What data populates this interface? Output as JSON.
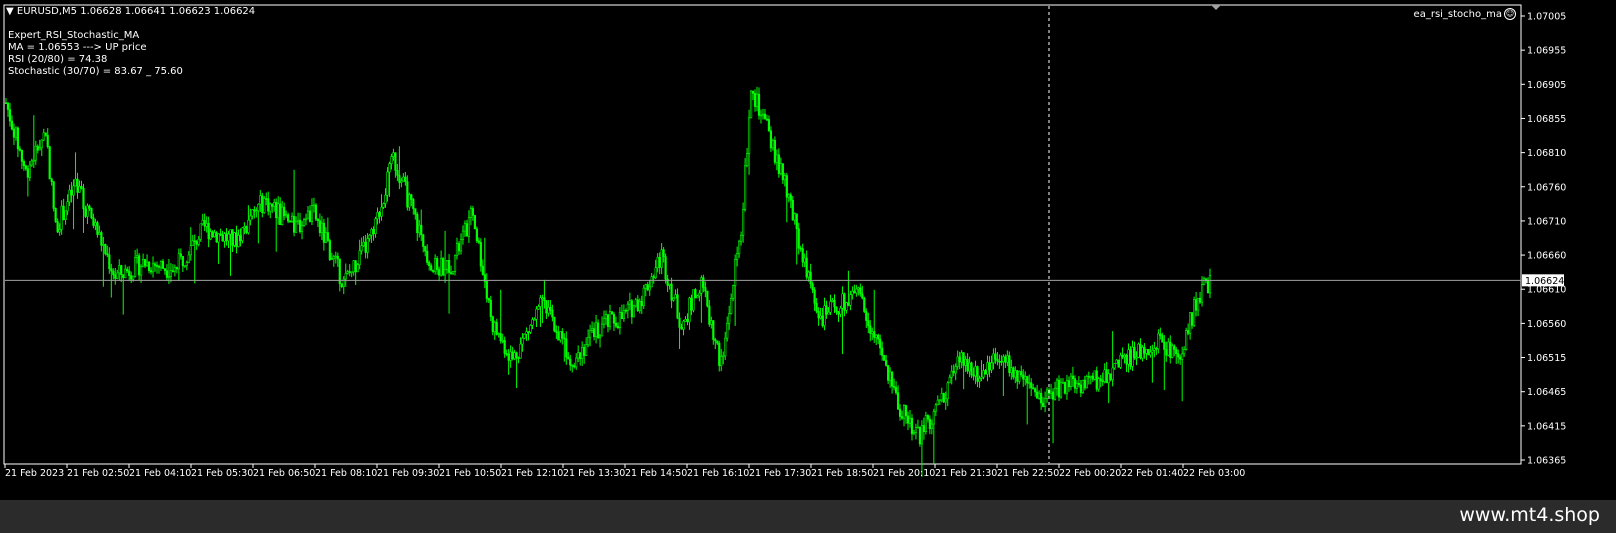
{
  "symbol_header": {
    "symbol": "EURUSD,M5",
    "ohlc": "1.06628 1.06641 1.06623 1.06624"
  },
  "indicator_name": "ea_rsi_stocho_ma",
  "info_lines": [
    "Expert_RSI_Stochastic_MA",
    "MA = 1.06553 ---> UP price",
    "RSI (20/80) = 74.38",
    "Stochastic (30/70) = 83.67 _ 75.60"
  ],
  "footer": "www.mt4.shop",
  "colors": {
    "background": "#000000",
    "candle": "#00ff00",
    "grid_frame": "#ffffff",
    "price_line": "#a0a0a0",
    "current_price_tag_bg": "#ffffff",
    "footer_bg": "#2b2b2b"
  },
  "chart_data": {
    "type": "candlestick",
    "ylim": [
      1.06365,
      1.07005
    ],
    "y_ticks": [
      "1.07005",
      "1.06955",
      "1.06905",
      "1.06855",
      "1.06810",
      "1.06760",
      "1.06710",
      "1.06660",
      "1.06610",
      "1.06560",
      "1.06515",
      "1.06465",
      "1.06415",
      "1.06365"
    ],
    "current_price": "1.06624",
    "x_ticks": [
      "21 Feb 2023",
      "21 Feb 02:50",
      "21 Feb 04:10",
      "21 Feb 05:30",
      "21 Feb 06:50",
      "21 Feb 08:10",
      "21 Feb 09:30",
      "21 Feb 10:50",
      "21 Feb 12:10",
      "21 Feb 13:30",
      "21 Feb 14:50",
      "21 Feb 16:10",
      "21 Feb 17:30",
      "21 Feb 18:50",
      "21 Feb 20:10",
      "21 Feb 21:30",
      "21 Feb 22:50",
      "22 Feb 00:20",
      "22 Feb 01:40",
      "22 Feb 03:00"
    ],
    "session_separator_after": "21 Feb 22:50",
    "close_anchors": [
      [
        0,
        1.0688
      ],
      [
        10,
        1.0678
      ],
      [
        20,
        1.0684
      ],
      [
        25,
        1.067
      ],
      [
        35,
        1.0676
      ],
      [
        45,
        1.067
      ],
      [
        55,
        1.0663
      ],
      [
        70,
        1.0665
      ],
      [
        85,
        1.0664
      ],
      [
        100,
        1.067
      ],
      [
        115,
        1.0668
      ],
      [
        130,
        1.0674
      ],
      [
        145,
        1.067
      ],
      [
        155,
        1.0672
      ],
      [
        170,
        1.0662
      ],
      [
        185,
        1.0669
      ],
      [
        195,
        1.068
      ],
      [
        205,
        1.0672
      ],
      [
        215,
        1.0664
      ],
      [
        225,
        1.0665
      ],
      [
        235,
        1.0672
      ],
      [
        245,
        1.0656
      ],
      [
        255,
        1.0651
      ],
      [
        270,
        1.0659
      ],
      [
        285,
        1.0651
      ],
      [
        300,
        1.0656
      ],
      [
        310,
        1.0657
      ],
      [
        320,
        1.066
      ],
      [
        330,
        1.0666
      ],
      [
        340,
        1.0656
      ],
      [
        350,
        1.0662
      ],
      [
        360,
        1.065
      ],
      [
        370,
        1.067
      ],
      [
        375,
        1.069
      ],
      [
        382,
        1.0685
      ],
      [
        392,
        1.0676
      ],
      [
        402,
        1.0665
      ],
      [
        410,
        1.0657
      ],
      [
        420,
        1.0659
      ],
      [
        430,
        1.066
      ],
      [
        440,
        1.0652
      ],
      [
        450,
        1.0644
      ],
      [
        460,
        1.064
      ],
      [
        470,
        1.0645
      ],
      [
        480,
        1.0651
      ],
      [
        490,
        1.0649
      ],
      [
        500,
        1.0652
      ],
      [
        510,
        1.0648
      ],
      [
        520,
        1.0645
      ],
      [
        530,
        1.0647
      ],
      [
        540,
        1.06475
      ],
      [
        550,
        1.0648
      ],
      [
        560,
        1.065
      ],
      [
        570,
        1.0652
      ],
      [
        580,
        1.0654
      ],
      [
        590,
        1.0651
      ],
      [
        600,
        1.066
      ],
      [
        606,
        1.06624
      ]
    ]
  }
}
